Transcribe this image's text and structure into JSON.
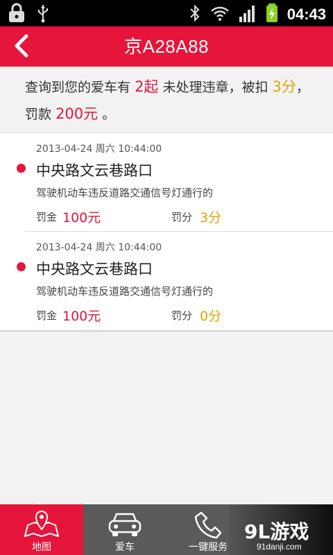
{
  "status_bar": {
    "time": "04:43"
  },
  "header": {
    "title": "京A28A88"
  },
  "summary": {
    "prefix": "查询到您的爱车有",
    "count": "2起",
    "middle": "未处理违章，被扣",
    "points": "3分",
    "comma": "，",
    "fine_prefix": "罚款",
    "fine": "200元",
    "period": "。"
  },
  "violations": [
    {
      "datetime": "2013-04-24 周六 10:44:00",
      "location": "中央路文云巷路口",
      "description": "驾驶机动车违反道路交通信号灯通行的",
      "fine_label": "罚金",
      "fine": "100元",
      "points_label": "罚分",
      "points": "3分"
    },
    {
      "datetime": "2013-04-24 周六 10:44:00",
      "location": "中央路文云巷路口",
      "description": "驾驶机动车违反道路交通信号灯通行的",
      "fine_label": "罚金",
      "fine": "100元",
      "points_label": "罚分",
      "points": "0分"
    }
  ],
  "tabs": [
    {
      "label": "地图",
      "icon": "map-icon",
      "active": true
    },
    {
      "label": "爱车",
      "icon": "car-icon",
      "active": false
    },
    {
      "label": "一键服务",
      "icon": "phone-icon",
      "active": false
    }
  ],
  "watermark": {
    "logo": "9L游戏",
    "site": "91danji.com"
  },
  "colors": {
    "accent": "#e5153b",
    "points": "#e0a500",
    "tabbar": "#5a5a5a"
  }
}
